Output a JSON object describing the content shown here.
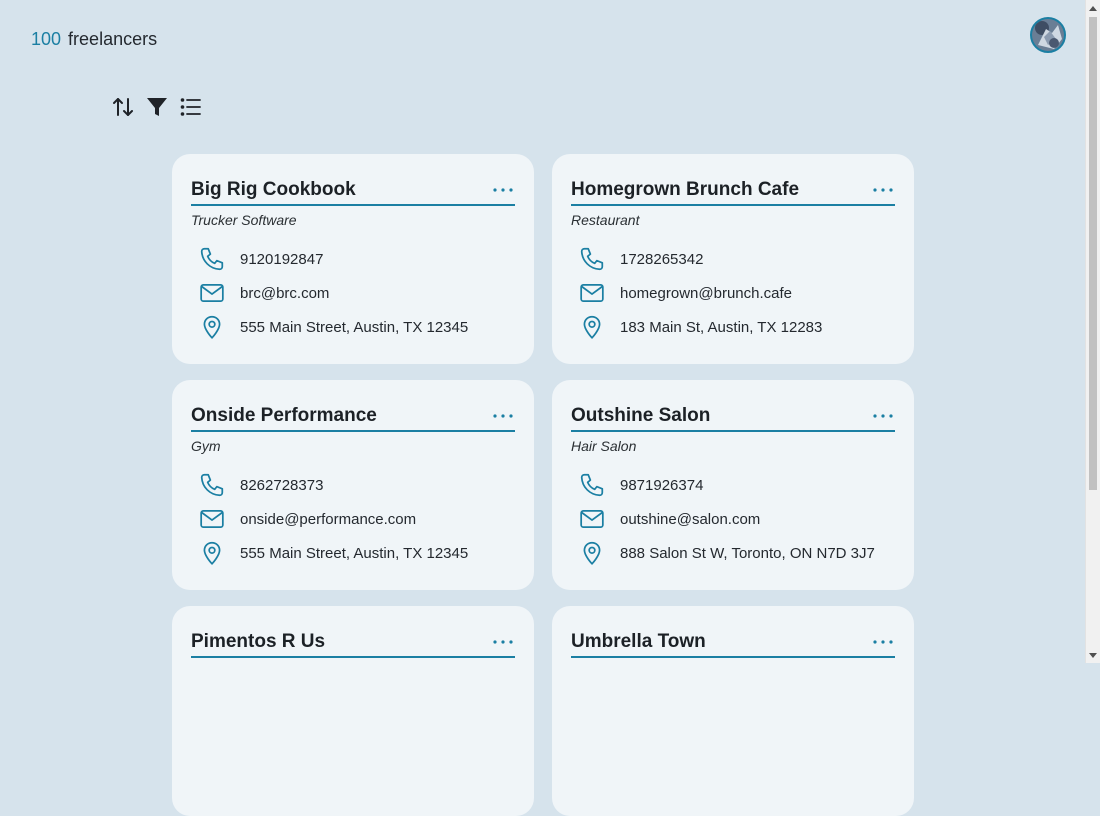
{
  "header": {
    "count": "100",
    "label": "freelancers"
  },
  "toolbar": {
    "icons": [
      "sort-icon",
      "filter-icon",
      "list-view-icon"
    ]
  },
  "colors": {
    "accent": "#1b7fa3",
    "background": "#d6e3ec",
    "card": "#f0f5f8"
  },
  "cards": [
    {
      "name": "Big Rig Cookbook",
      "category": "Trucker Software",
      "phone": "9120192847",
      "email": "brc@brc.com",
      "address": "555 Main Street, Austin, TX 12345"
    },
    {
      "name": "Homegrown Brunch Cafe",
      "category": "Restaurant",
      "phone": "1728265342",
      "email": "homegrown@brunch.cafe",
      "address": "183 Main St, Austin, TX 12283"
    },
    {
      "name": "Onside Performance",
      "category": "Gym",
      "phone": "8262728373",
      "email": "onside@performance.com",
      "address": "555 Main Street, Austin, TX 12345"
    },
    {
      "name": "Outshine Salon",
      "category": "Hair Salon",
      "phone": "9871926374",
      "email": "outshine@salon.com",
      "address": "888 Salon St W, Toronto, ON N7D 3J7"
    },
    {
      "name": "Pimentos R Us",
      "category": "",
      "phone": "",
      "email": "",
      "address": ""
    },
    {
      "name": "Umbrella Town",
      "category": "",
      "phone": "",
      "email": "",
      "address": ""
    }
  ]
}
